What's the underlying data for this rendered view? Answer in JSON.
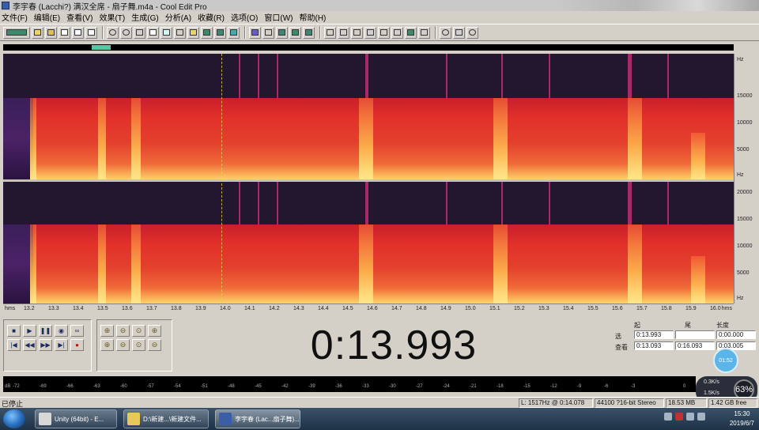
{
  "window": {
    "title": "李宇春 (Lacchi?) 满汉全席 - 扇子舞.m4a - Cool Edit Pro"
  },
  "menu": [
    "文件(F)",
    "编辑(E)",
    "查看(V)",
    "效果(T)",
    "生成(G)",
    "分析(A)",
    "收藏(R)",
    "选项(O)",
    "窗口(W)",
    "帮助(H)"
  ],
  "spectral": {
    "freq_labels_ch1": [
      "Hz",
      "15000",
      "10000",
      "5000",
      "Hz"
    ],
    "freq_labels_ch2": [
      "20000",
      "15000",
      "10000",
      "5000",
      "Hz"
    ],
    "time_unit": "hms",
    "time_labels": [
      "13.2",
      "13.3",
      "13.4",
      "13.5",
      "13.6",
      "13.7",
      "13.8",
      "13.9",
      "14.0",
      "14.1",
      "14.2",
      "14.3",
      "14.4",
      "14.5",
      "14.6",
      "14.7",
      "14.8",
      "14.9",
      "15.0",
      "15.1",
      "15.2",
      "15.3",
      "15.4",
      "15.5",
      "15.6",
      "15.7",
      "15.8",
      "15.9",
      "16.0"
    ]
  },
  "transport": {
    "row1": [
      "■",
      "▶",
      "❚❚",
      "◉",
      "∞"
    ],
    "row2": [
      "|◀",
      "◀◀",
      "▶▶",
      "▶|",
      "●"
    ]
  },
  "time_display": "0:13.993",
  "selection": {
    "headers": [
      "起",
      "尾",
      "长度"
    ],
    "rows": [
      {
        "label": "选",
        "start": "0:13.993",
        "end": "",
        "length": "0:00.000"
      },
      {
        "label": "查看",
        "start": "0:13.093",
        "end": "0:16.093",
        "length": "0:03.005"
      }
    ]
  },
  "cpu_badge": "01:52",
  "level_meter": {
    "labels": [
      "dB",
      "-72",
      "-69",
      "-66",
      "-63",
      "-60",
      "-57",
      "-54",
      "-51",
      "-48",
      "-45",
      "-42",
      "-39",
      "-36",
      "-33",
      "-30",
      "-27",
      "-24",
      "-21",
      "-18",
      "-15",
      "-12",
      "-9",
      "-6",
      "-3",
      "0"
    ]
  },
  "network": {
    "up": "0.3K/s",
    "down": "1.5K/s",
    "percent": "63%"
  },
  "status": {
    "left": "已停止",
    "cells": [
      "L: 1517Hz @ 0:14.078",
      "44100 ?16-bit Stereo",
      "18.53 MB",
      "1.42 GB free"
    ]
  },
  "taskbar": {
    "items": [
      "Unity (64bit) - E...",
      "D:\\新建...\\新建文件...",
      "李宇春 (Lac...扇子舞)..."
    ],
    "clock_time": "15:30",
    "clock_date": "2019/6/7"
  },
  "colors": {
    "spectral_hot": "#ffd56a",
    "spectral_mid": "#e2312a",
    "spectral_dark": "#22172e",
    "selection_overview": "#57c8a6"
  }
}
